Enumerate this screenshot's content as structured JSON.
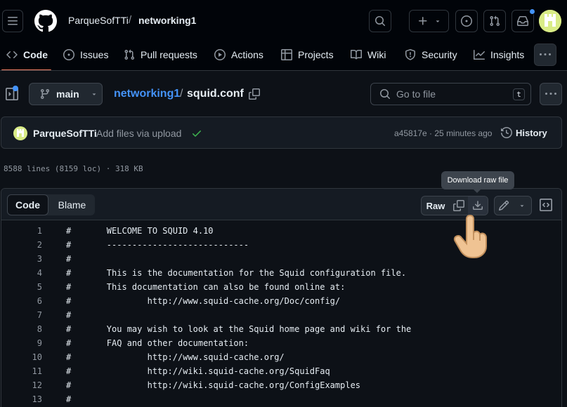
{
  "header": {
    "owner": "ParqueSofTTi",
    "separator": "/",
    "repo": "networking1"
  },
  "nav": {
    "items": [
      {
        "label": "Code"
      },
      {
        "label": "Issues"
      },
      {
        "label": "Pull requests"
      },
      {
        "label": "Actions"
      },
      {
        "label": "Projects"
      },
      {
        "label": "Wiki"
      },
      {
        "label": "Security"
      },
      {
        "label": "Insights"
      }
    ],
    "active": "Code"
  },
  "filebar": {
    "branch": "main",
    "repo_link": "networking1",
    "separator": "/",
    "filename": "squid.conf",
    "goto_placeholder": "Go to file",
    "goto_shortcut": "t"
  },
  "commit": {
    "author": "ParqueSofTTi",
    "message": "Add files via upload",
    "hash_time": "a45817e · 25 minutes ago",
    "history_label": "History"
  },
  "file_info": "8588 lines (8159 loc) · 318 KB",
  "viewer": {
    "tab_code": "Code",
    "tab_blame": "Blame",
    "raw_label": "Raw",
    "tooltip": "Download raw file"
  },
  "code_lines": [
    {
      "n": "1",
      "text": "#       WELCOME TO SQUID 4.10"
    },
    {
      "n": "2",
      "text": "#       ----------------------------"
    },
    {
      "n": "3",
      "text": "#"
    },
    {
      "n": "4",
      "text": "#       This is the documentation for the Squid configuration file."
    },
    {
      "n": "5",
      "text": "#       This documentation can also be found online at:"
    },
    {
      "n": "6",
      "text": "#               http://www.squid-cache.org/Doc/config/"
    },
    {
      "n": "7",
      "text": "#"
    },
    {
      "n": "8",
      "text": "#       You may wish to look at the Squid home page and wiki for the"
    },
    {
      "n": "9",
      "text": "#       FAQ and other documentation:"
    },
    {
      "n": "10",
      "text": "#               http://www.squid-cache.org/"
    },
    {
      "n": "11",
      "text": "#               http://wiki.squid-cache.org/SquidFaq"
    },
    {
      "n": "12",
      "text": "#               http://wiki.squid-cache.org/ConfigExamples"
    },
    {
      "n": "13",
      "text": "#"
    }
  ],
  "colors": {
    "background": "#0d1117",
    "link": "#4493f8",
    "active_underline": "#f78166",
    "success_check": "#3fb950",
    "notification_dot": "#4493f8"
  },
  "icons": [
    "menu-icon",
    "github-logo",
    "search-icon",
    "plus-icon",
    "issue-icon",
    "pull-request-icon",
    "inbox-icon",
    "avatar",
    "code-icon",
    "play-icon",
    "table-icon",
    "book-icon",
    "shield-icon",
    "graph-icon",
    "kebab-icon",
    "sidebar-icon",
    "branch-icon",
    "copy-icon",
    "history-icon",
    "download-icon",
    "pencil-icon",
    "symbols-icon",
    "pointer-hand-icon"
  ]
}
